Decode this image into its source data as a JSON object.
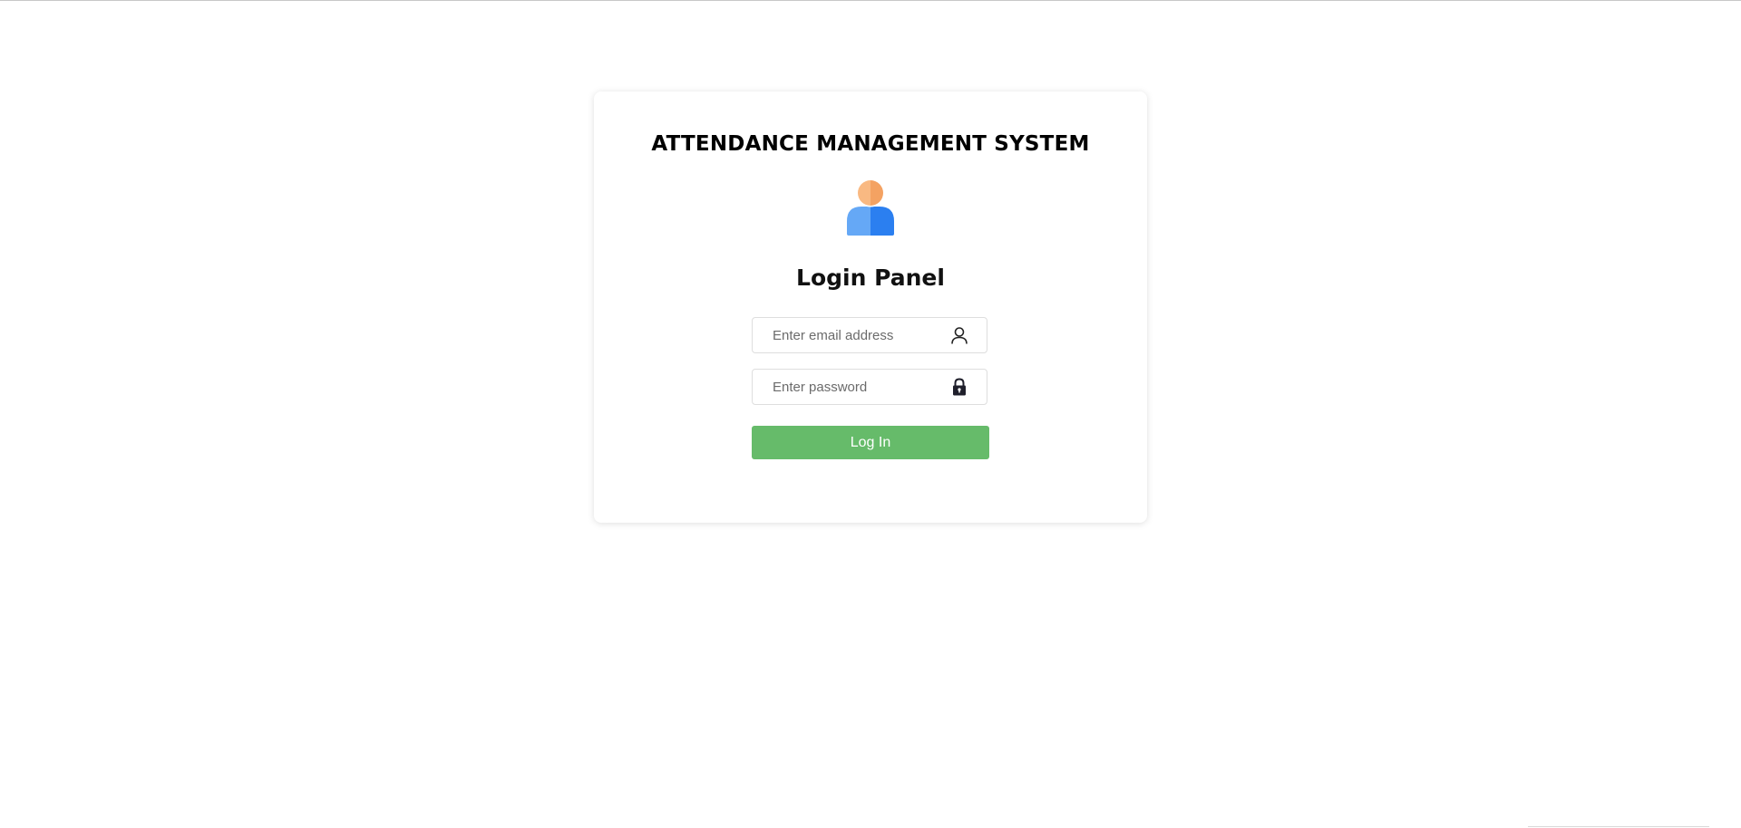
{
  "page": {
    "title": "ATTENDANCE MANAGEMENT SYSTEM"
  },
  "login": {
    "heading": "Login Panel",
    "email": {
      "placeholder": "Enter email address",
      "value": "",
      "icon": "user-icon"
    },
    "password": {
      "placeholder": "Enter password",
      "value": "",
      "icon": "lock-icon"
    },
    "submit_label": "Log In"
  },
  "avatar": {
    "icon": "user-avatar-icon"
  },
  "colors": {
    "button": "#66bb6a",
    "avatar_head": "#f7a96b",
    "avatar_body_left": "#5fa5f5",
    "avatar_body_right": "#2f80ed"
  }
}
